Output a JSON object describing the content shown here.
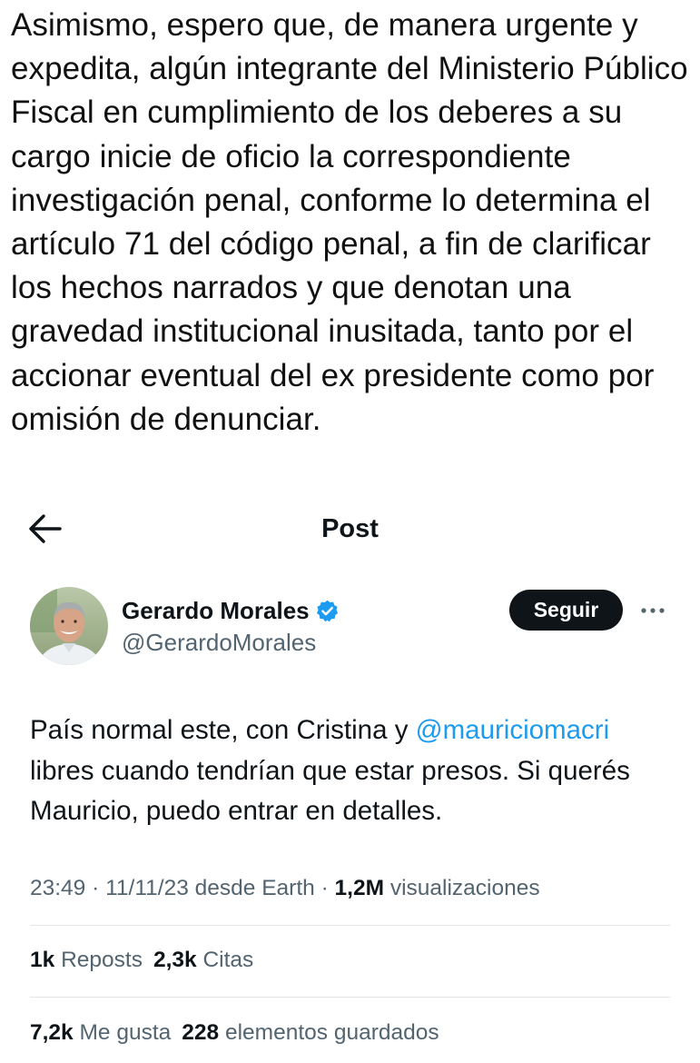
{
  "intro_text": "Asimismo, espero que, de manera urgente y expedita, algún integrante del Ministerio Público Fiscal en cumplimiento de los deberes a su cargo inicie de oficio la correspondiente investigación penal, conforme lo determina el artículo 71 del código penal, a fin de clarificar los hechos narrados y que denotan una gravedad institucional inusitada, tanto por el accionar eventual del ex presidente como por omisión de denunciar.",
  "header": {
    "title": "Post",
    "back_icon": "arrow-left-icon"
  },
  "author": {
    "name": "Gerardo Morales",
    "handle": "@GerardoMorales",
    "verified_icon": "verified-badge-icon",
    "verified_color": "#1d9bf0"
  },
  "actions": {
    "follow_label": "Seguir",
    "more_icon": "more-horizontal-icon"
  },
  "tweet": {
    "text_before": "País normal este, con Cristina y ",
    "mention": "@mauriciomacri",
    "text_after": " libres cuando tendrían que estar presos. Si querés Mauricio, puedo entrar en detalles."
  },
  "meta": {
    "time": "23:49",
    "date": "11/11/23",
    "source": "desde Earth",
    "sep": " · ",
    "views_count": "1,2M",
    "views_label": "visualizaciones"
  },
  "stats": {
    "reposts_count": "1k",
    "reposts_label": "Reposts",
    "quotes_count": "2,3k",
    "quotes_label": "Citas",
    "likes_count": "7,2k",
    "likes_label": "Me gusta",
    "bookmarks_count": "228",
    "bookmarks_label": "elementos guardados"
  },
  "colors": {
    "text_primary": "#0f1419",
    "text_secondary": "#536471",
    "link": "#1d9bf0",
    "follow_bg": "#0f1419",
    "divider": "#e1e6ea"
  }
}
